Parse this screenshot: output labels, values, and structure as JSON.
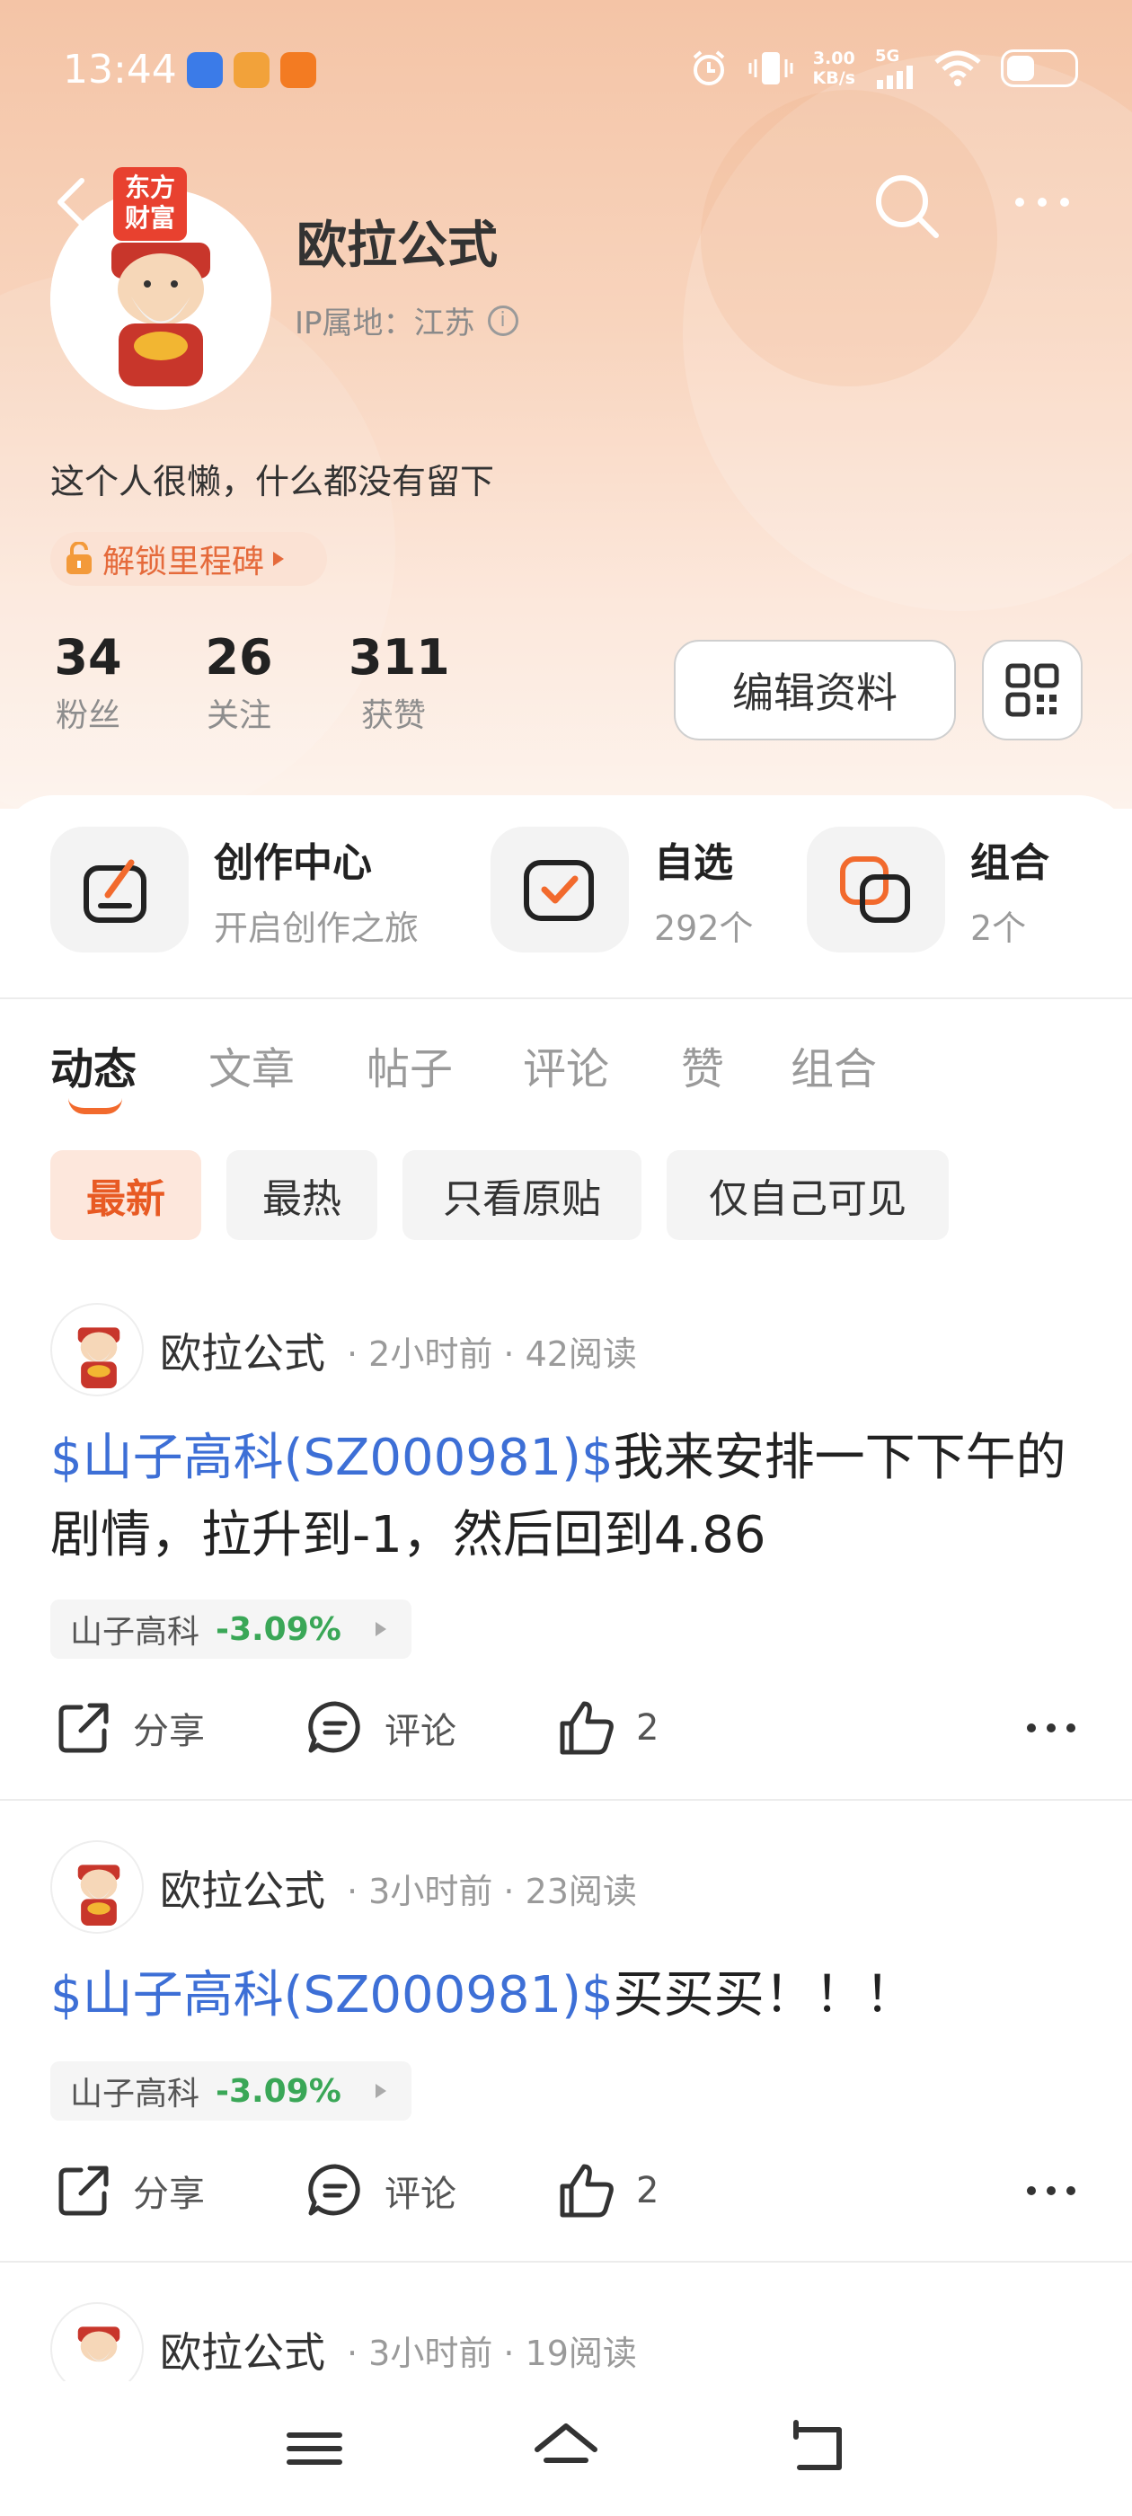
{
  "status_bar": {
    "time": "13:44",
    "speed_value": "3.00",
    "speed_unit": "KB/s",
    "network": "5G"
  },
  "profile": {
    "brand_tag": "东方\n财富",
    "name": "欧拉公式",
    "ip_label": "IP属地：江苏",
    "bio": "这个人很懒，什么都没有留下",
    "milestone": "解锁里程碑"
  },
  "stats": [
    {
      "value": "34",
      "label": "粉丝"
    },
    {
      "value": "26",
      "label": "关注"
    },
    {
      "value": "311",
      "label": "获赞"
    }
  ],
  "buttons": {
    "edit_profile": "编辑资料"
  },
  "features": [
    {
      "title": "创作中心",
      "subtitle": "开启创作之旅"
    },
    {
      "title": "自选",
      "subtitle": "292个"
    },
    {
      "title": "组合",
      "subtitle": "2个"
    }
  ],
  "tabs": [
    "动态",
    "文章",
    "帖子",
    "评论",
    "赞",
    "组合"
  ],
  "filters": [
    "最新",
    "最热",
    "只看原贴",
    "仅自己可见"
  ],
  "posts": [
    {
      "author": "欧拉公式",
      "meta": "· 2小时前 · 42阅读",
      "stock_tag": "$山子高科(SZ000981)$",
      "text": "我来安排一下下午的剧情，拉升到-1，然后回到4.86",
      "stock_name": "山子高科",
      "stock_change": "-3.09%",
      "share": "分享",
      "comment": "评论",
      "likes": "2"
    },
    {
      "author": "欧拉公式",
      "meta": "· 3小时前 · 23阅读",
      "stock_tag": "$山子高科(SZ000981)$",
      "text": "买买买！！！",
      "stock_name": "山子高科",
      "stock_change": "-3.09%",
      "share": "分享",
      "comment": "评论",
      "likes": "2"
    },
    {
      "author": "欧拉公式",
      "meta": "· 3小时前 · 19阅读"
    }
  ],
  "colors": {
    "accent": "#f26a2d",
    "link": "#3d6fd6",
    "stock_down": "#3aa757"
  }
}
